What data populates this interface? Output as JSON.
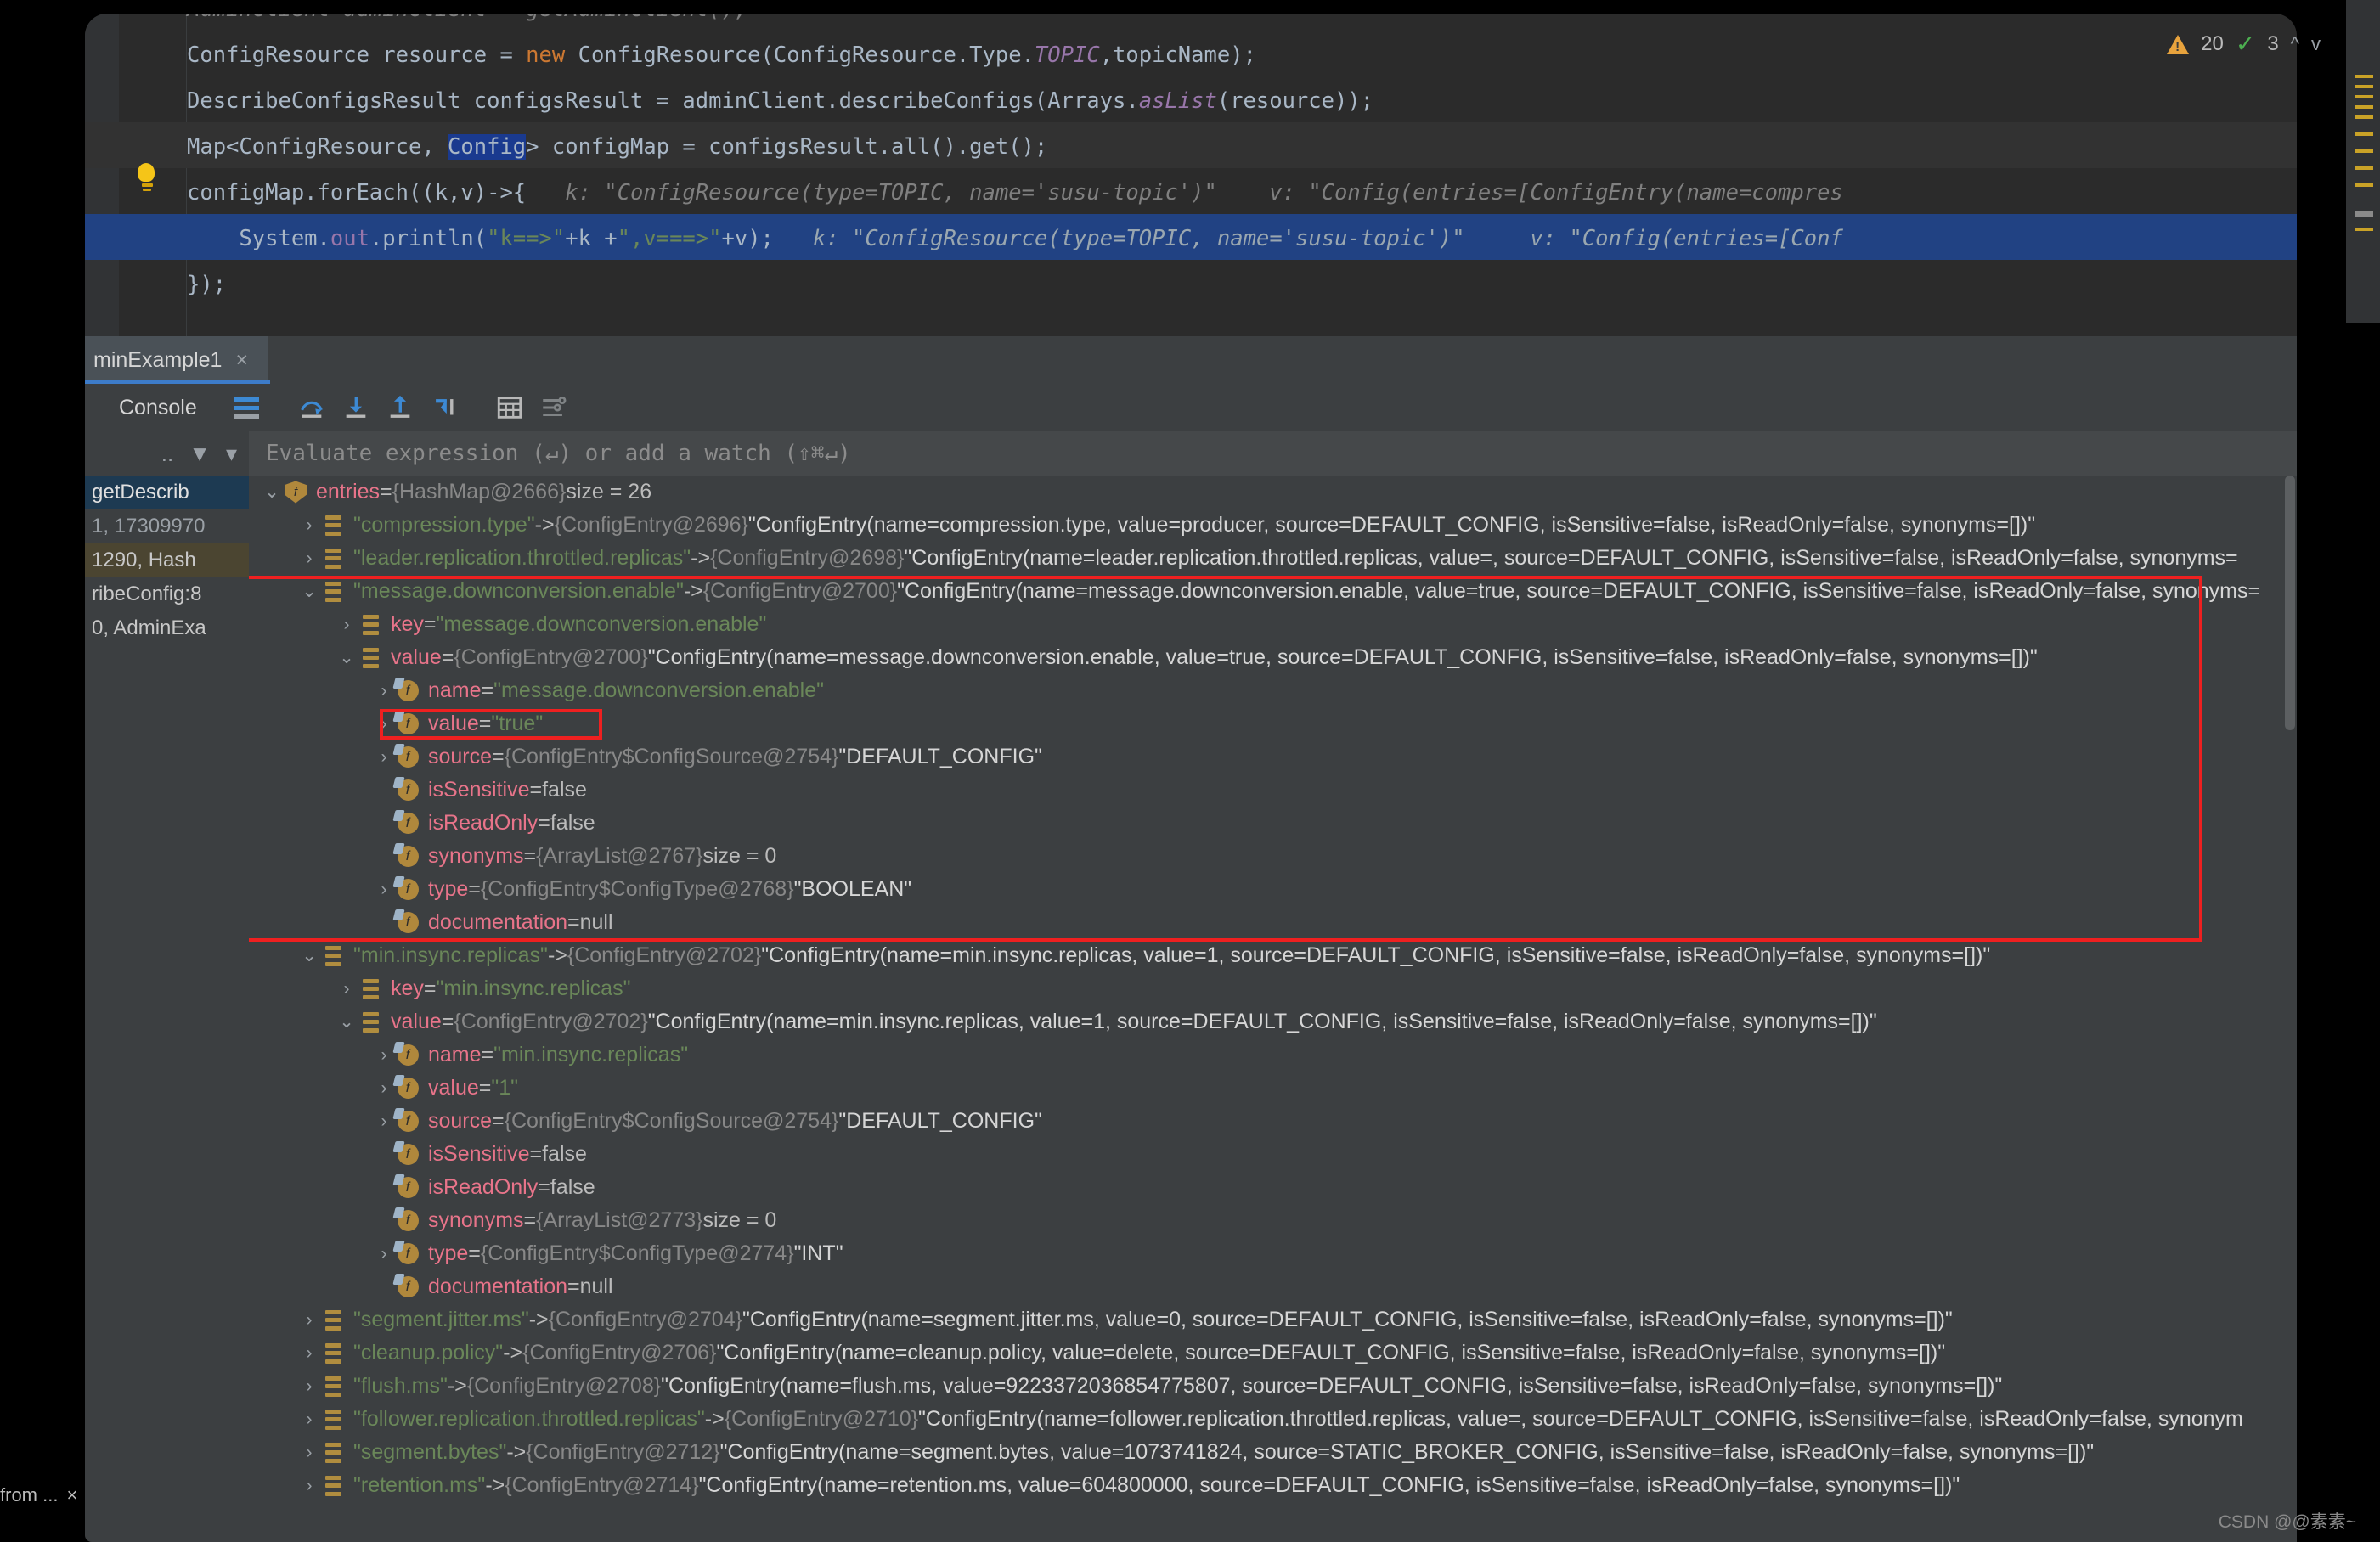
{
  "editor": {
    "lines": [
      {
        "segments": [
          {
            "t": "AdminClient adminClient = getAdminClient();",
            "c": "dim"
          }
        ]
      },
      {
        "segments": [
          {
            "t": "ConfigResource resource = ",
            "c": "plain"
          },
          {
            "t": "new",
            "c": "kw"
          },
          {
            "t": " ConfigResource(ConfigResource.Type.",
            "c": "plain"
          },
          {
            "t": "TOPIC",
            "c": "static"
          },
          {
            "t": ",topicName);",
            "c": "plain"
          }
        ]
      },
      {
        "segments": [
          {
            "t": "DescribeConfigsResult configsResult = adminClient.describeConfigs(Arrays.",
            "c": "plain"
          },
          {
            "t": "asList",
            "c": "static"
          },
          {
            "t": "(resource));",
            "c": "plain"
          }
        ]
      },
      {
        "segments": [
          {
            "t": "Map<ConfigResource, ",
            "c": "plain"
          },
          {
            "t": "Config",
            "c": "sel"
          },
          {
            "t": "> configMap = configsResult.all().get();",
            "c": "plain"
          }
        ]
      },
      {
        "segments": [
          {
            "t": "configMap.forEach((k,v)->{",
            "c": "plain"
          },
          {
            "t": "   k: ",
            "c": "hint"
          },
          {
            "t": "\"ConfigResource(type=TOPIC, name='susu-topic')\"",
            "c": "hint"
          },
          {
            "t": "    v: ",
            "c": "hint"
          },
          {
            "t": "\"Config(entries=[ConfigEntry(name=compres",
            "c": "hint"
          }
        ]
      },
      {
        "segments": [
          {
            "t": "    System.",
            "c": "plain"
          },
          {
            "t": "out",
            "c": "field"
          },
          {
            "t": ".println(",
            "c": "plain"
          },
          {
            "t": "\"k==>\"",
            "c": "str"
          },
          {
            "t": "+k +",
            "c": "plain"
          },
          {
            "t": "\",v===>\"",
            "c": "str"
          },
          {
            "t": "+v);",
            "c": "plain"
          },
          {
            "t": "   k: ",
            "c": "hintb"
          },
          {
            "t": "\"ConfigResource(type=TOPIC, name='susu-topic')\"",
            "c": "hintb"
          },
          {
            "t": "     v: ",
            "c": "hintb"
          },
          {
            "t": "\"Config(entries=[Conf",
            "c": "hintb"
          }
        ]
      },
      {
        "segments": [
          {
            "t": "});",
            "c": "plain"
          }
        ]
      }
    ],
    "status": {
      "warning_count": "20",
      "check_count": "3",
      "up_arrow": "^",
      "down_arrow": "v"
    }
  },
  "tab": {
    "label": "minExample1",
    "close": "×"
  },
  "console": {
    "label": "Console",
    "buttons": [
      "wrap-lines-icon",
      "step-over-icon",
      "step-into-icon",
      "step-out-icon",
      "run-to-cursor-icon",
      "table-view-icon",
      "settings-icon"
    ]
  },
  "left_panel": {
    "toolbar": [
      "more-icon",
      "filter-icon",
      "dropdown-icon"
    ],
    "items": [
      {
        "text": "getDescrib",
        "state": "sel"
      },
      {
        "text": "1, 17309970",
        "state": "dim"
      },
      {
        "text": "1290, Hash",
        "state": "hl"
      },
      {
        "text": "ribeConfig:8",
        "state": "normal"
      },
      {
        "text": "0, AdminExa",
        "state": "normal"
      }
    ],
    "footer": "from ..."
  },
  "evaluate_bar": {
    "placeholder": "Evaluate expression (↵) or add a watch (⇧⌘↵)"
  },
  "tree": [
    {
      "indent": 0,
      "arrow": "down",
      "icon": "shield",
      "name": "entries",
      "eq": " = ",
      "ref": "{HashMap@2666}",
      "suffix": "size = 26"
    },
    {
      "indent": 1,
      "arrow": "right",
      "icon": "entry",
      "str": "\"compression.type\"",
      "op": " -> ",
      "ref": "{ConfigEntry@2696}",
      "tostr": "\"ConfigEntry(name=compression.type, value=producer, source=DEFAULT_CONFIG, isSensitive=false, isReadOnly=false, synonyms=[])\""
    },
    {
      "indent": 1,
      "arrow": "right",
      "icon": "entry",
      "str": "\"leader.replication.throttled.replicas\"",
      "op": " -> ",
      "ref": "{ConfigEntry@2698}",
      "tostr": "\"ConfigEntry(name=leader.replication.throttled.replicas, value=, source=DEFAULT_CONFIG, isSensitive=false, isReadOnly=false, synonyms="
    },
    {
      "indent": 1,
      "arrow": "down",
      "icon": "entry",
      "str": "\"message.downconversion.enable\"",
      "op": " -> ",
      "ref": "{ConfigEntry@2700}",
      "tostr": "\"ConfigEntry(name=message.downconversion.enable, value=true, source=DEFAULT_CONFIG, isSensitive=false, isReadOnly=false, synonyms="
    },
    {
      "indent": 2,
      "arrow": "right",
      "icon": "entry",
      "name": "key",
      "eq": " = ",
      "str": "\"message.downconversion.enable\""
    },
    {
      "indent": 2,
      "arrow": "down",
      "icon": "entry",
      "name": "value",
      "eq": " = ",
      "ref": "{ConfigEntry@2700}",
      "tostr": "\"ConfigEntry(name=message.downconversion.enable, value=true, source=DEFAULT_CONFIG, isSensitive=false, isReadOnly=false, synonyms=[])\""
    },
    {
      "indent": 3,
      "arrow": "right",
      "icon": "field",
      "name": "name",
      "eq": " = ",
      "str": "\"message.downconversion.enable\""
    },
    {
      "indent": 3,
      "arrow": "right",
      "icon": "field",
      "name": "value",
      "eq": " = ",
      "str": "\"true\"",
      "boxed": true
    },
    {
      "indent": 3,
      "arrow": "right",
      "icon": "field",
      "name": "source",
      "eq": " = ",
      "ref": "{ConfigEntry$ConfigSource@2754}",
      "tostr": "\"DEFAULT_CONFIG\""
    },
    {
      "indent": 3,
      "arrow": "none",
      "icon": "field",
      "name": "isSensitive",
      "eq": " = ",
      "plain": "false"
    },
    {
      "indent": 3,
      "arrow": "none",
      "icon": "field",
      "name": "isReadOnly",
      "eq": " = ",
      "plain": "false"
    },
    {
      "indent": 3,
      "arrow": "none",
      "icon": "field",
      "name": "synonyms",
      "eq": " = ",
      "ref": "{ArrayList@2767}",
      "suffix": "size = 0"
    },
    {
      "indent": 3,
      "arrow": "right",
      "icon": "field",
      "name": "type",
      "eq": " = ",
      "ref": "{ConfigEntry$ConfigType@2768}",
      "tostr": "\"BOOLEAN\""
    },
    {
      "indent": 3,
      "arrow": "none",
      "icon": "field",
      "name": "documentation",
      "eq": " = ",
      "plain": "null"
    },
    {
      "indent": 1,
      "arrow": "down",
      "icon": "entry",
      "str": "\"min.insync.replicas\"",
      "op": " -> ",
      "ref": "{ConfigEntry@2702}",
      "tostr": "\"ConfigEntry(name=min.insync.replicas, value=1, source=DEFAULT_CONFIG, isSensitive=false, isReadOnly=false, synonyms=[])\""
    },
    {
      "indent": 2,
      "arrow": "right",
      "icon": "entry",
      "name": "key",
      "eq": " = ",
      "str": "\"min.insync.replicas\""
    },
    {
      "indent": 2,
      "arrow": "down",
      "icon": "entry",
      "name": "value",
      "eq": " = ",
      "ref": "{ConfigEntry@2702}",
      "tostr": "\"ConfigEntry(name=min.insync.replicas, value=1, source=DEFAULT_CONFIG, isSensitive=false, isReadOnly=false, synonyms=[])\""
    },
    {
      "indent": 3,
      "arrow": "right",
      "icon": "field",
      "name": "name",
      "eq": " = ",
      "str": "\"min.insync.replicas\""
    },
    {
      "indent": 3,
      "arrow": "right",
      "icon": "field",
      "name": "value",
      "eq": " = ",
      "str": "\"1\""
    },
    {
      "indent": 3,
      "arrow": "right",
      "icon": "field",
      "name": "source",
      "eq": " = ",
      "ref": "{ConfigEntry$ConfigSource@2754}",
      "tostr": "\"DEFAULT_CONFIG\""
    },
    {
      "indent": 3,
      "arrow": "none",
      "icon": "field",
      "name": "isSensitive",
      "eq": " = ",
      "plain": "false"
    },
    {
      "indent": 3,
      "arrow": "none",
      "icon": "field",
      "name": "isReadOnly",
      "eq": " = ",
      "plain": "false"
    },
    {
      "indent": 3,
      "arrow": "none",
      "icon": "field",
      "name": "synonyms",
      "eq": " = ",
      "ref": "{ArrayList@2773}",
      "suffix": "size = 0"
    },
    {
      "indent": 3,
      "arrow": "right",
      "icon": "field",
      "name": "type",
      "eq": " = ",
      "ref": "{ConfigEntry$ConfigType@2774}",
      "tostr": "\"INT\""
    },
    {
      "indent": 3,
      "arrow": "none",
      "icon": "field",
      "name": "documentation",
      "eq": " = ",
      "plain": "null"
    },
    {
      "indent": 1,
      "arrow": "right",
      "icon": "entry",
      "str": "\"segment.jitter.ms\"",
      "op": " -> ",
      "ref": "{ConfigEntry@2704}",
      "tostr": "\"ConfigEntry(name=segment.jitter.ms, value=0, source=DEFAULT_CONFIG, isSensitive=false, isReadOnly=false, synonyms=[])\""
    },
    {
      "indent": 1,
      "arrow": "right",
      "icon": "entry",
      "str": "\"cleanup.policy\"",
      "op": " -> ",
      "ref": "{ConfigEntry@2706}",
      "tostr": "\"ConfigEntry(name=cleanup.policy, value=delete, source=DEFAULT_CONFIG, isSensitive=false, isReadOnly=false, synonyms=[])\""
    },
    {
      "indent": 1,
      "arrow": "right",
      "icon": "entry",
      "str": "\"flush.ms\"",
      "op": " -> ",
      "ref": "{ConfigEntry@2708}",
      "tostr": "\"ConfigEntry(name=flush.ms, value=9223372036854775807, source=DEFAULT_CONFIG, isSensitive=false, isReadOnly=false, synonyms=[])\""
    },
    {
      "indent": 1,
      "arrow": "right",
      "icon": "entry",
      "str": "\"follower.replication.throttled.replicas\"",
      "op": " -> ",
      "ref": "{ConfigEntry@2710}",
      "tostr": "\"ConfigEntry(name=follower.replication.throttled.replicas, value=, source=DEFAULT_CONFIG, isSensitive=false, isReadOnly=false, synonym"
    },
    {
      "indent": 1,
      "arrow": "right",
      "icon": "entry",
      "str": "\"segment.bytes\"",
      "op": " -> ",
      "ref": "{ConfigEntry@2712}",
      "tostr": "\"ConfigEntry(name=segment.bytes, value=1073741824, source=STATIC_BROKER_CONFIG, isSensitive=false, isReadOnly=false, synonyms=[])\""
    },
    {
      "indent": 1,
      "arrow": "right",
      "icon": "entry",
      "str": "\"retention.ms\"",
      "op": " -> ",
      "ref": "{ConfigEntry@2714}",
      "tostr": "\"ConfigEntry(name=retention.ms, value=604800000, source=DEFAULT_CONFIG, isSensitive=false, isReadOnly=false, synonyms=[])\""
    }
  ],
  "watermark": "CSDN @@素素~"
}
